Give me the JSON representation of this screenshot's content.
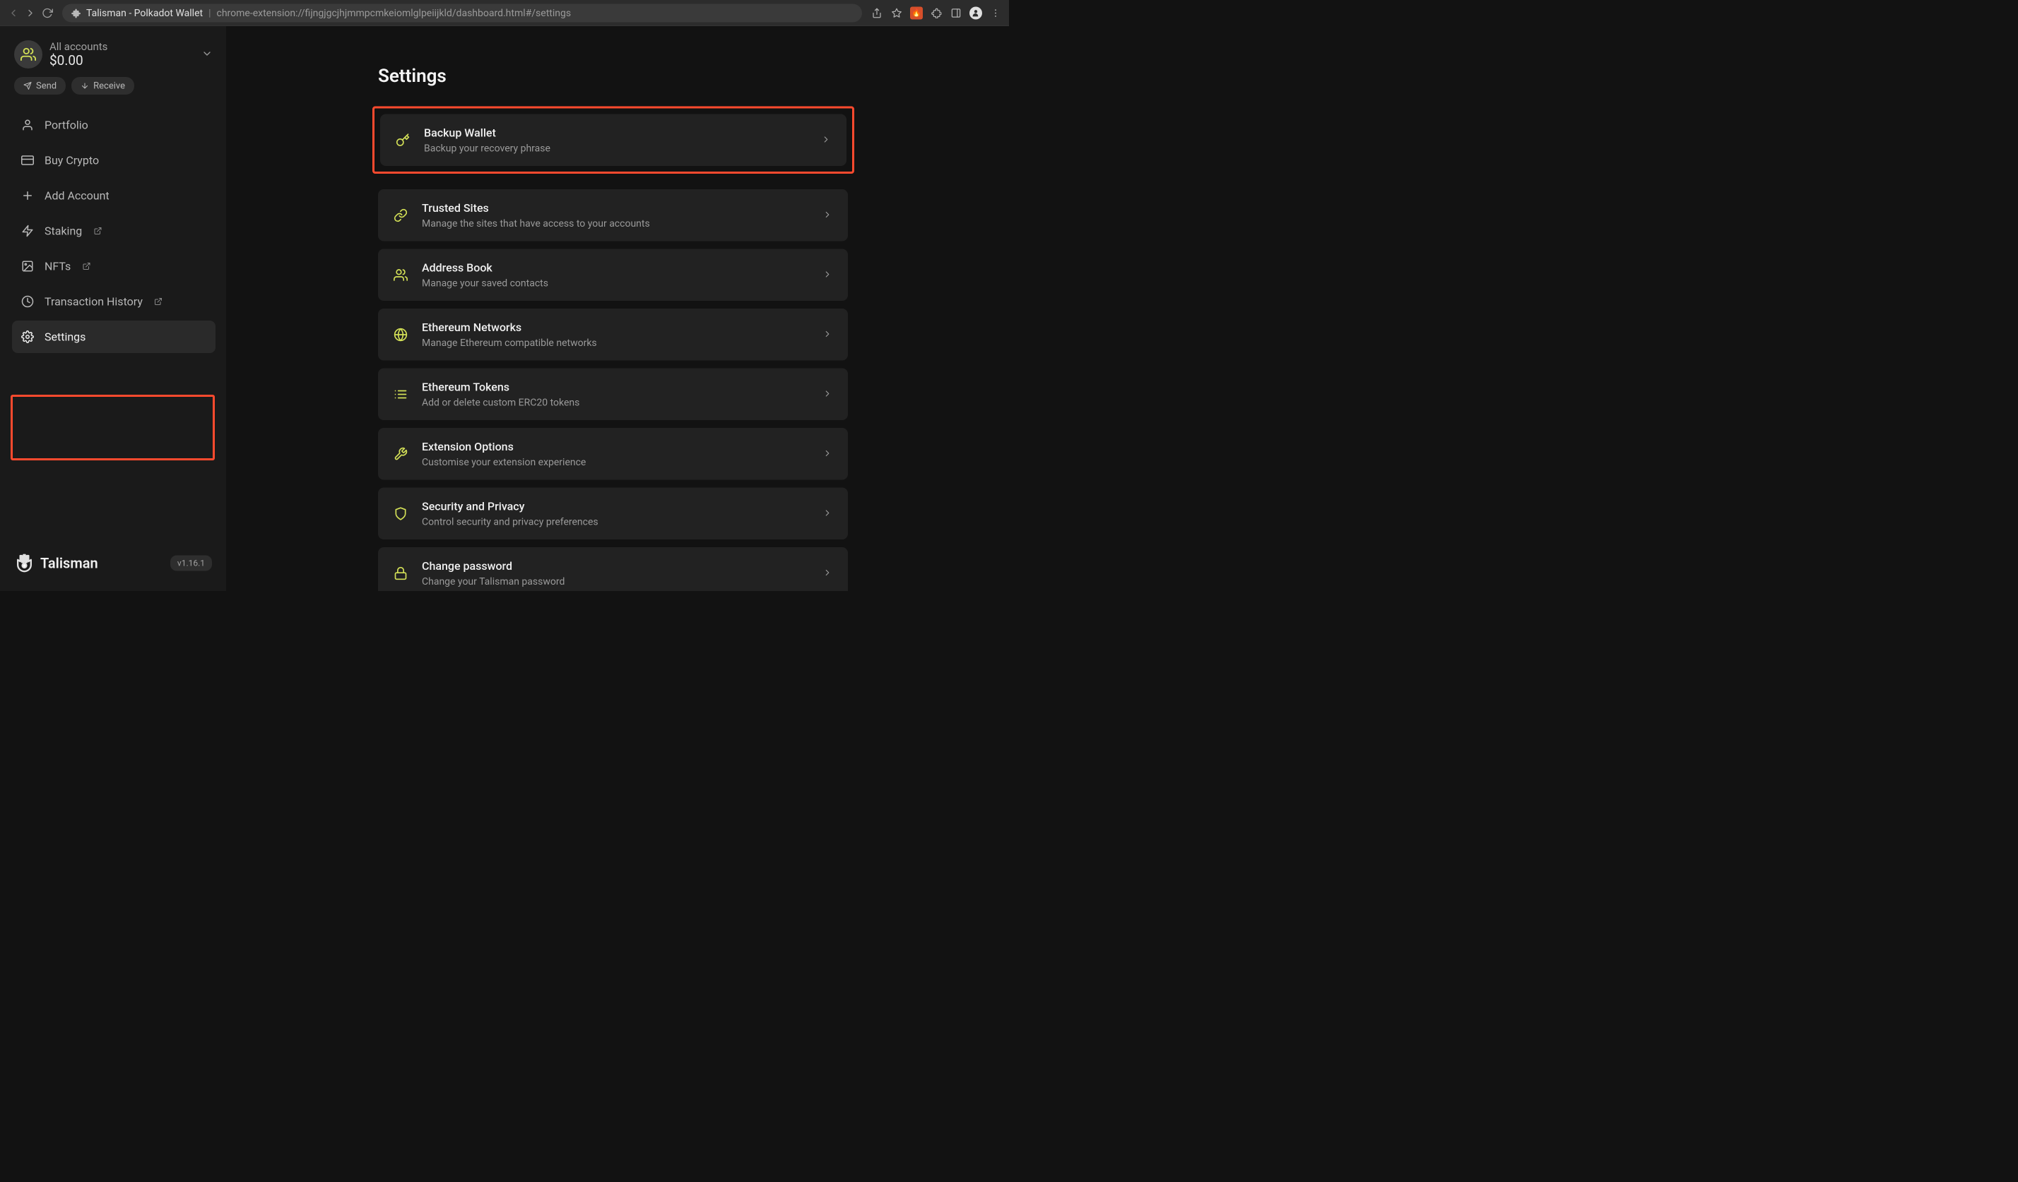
{
  "chrome": {
    "title": "Talisman - Polkadot Wallet",
    "url": "chrome-extension://fijngjgcjhjmmpcmkeiomlglpeiijkld/dashboard.html#/settings"
  },
  "sidebar": {
    "account_label": "All accounts",
    "account_balance": "$0.00",
    "send_label": "Send",
    "receive_label": "Receive",
    "items": [
      {
        "label": "Portfolio"
      },
      {
        "label": "Buy Crypto"
      },
      {
        "label": "Add Account"
      },
      {
        "label": "Staking"
      },
      {
        "label": "NFTs"
      },
      {
        "label": "Transaction History"
      },
      {
        "label": "Settings"
      }
    ],
    "brand": "Talisman",
    "version": "v1.16.1"
  },
  "main": {
    "title": "Settings",
    "rows": [
      {
        "title": "Backup Wallet",
        "desc": "Backup your recovery phrase"
      },
      {
        "title": "Trusted Sites",
        "desc": "Manage the sites that have access to your accounts"
      },
      {
        "title": "Address Book",
        "desc": "Manage your saved contacts"
      },
      {
        "title": "Ethereum Networks",
        "desc": "Manage Ethereum compatible networks"
      },
      {
        "title": "Ethereum Tokens",
        "desc": "Add or delete custom ERC20 tokens"
      },
      {
        "title": "Extension Options",
        "desc": "Customise your extension experience"
      },
      {
        "title": "Security and Privacy",
        "desc": "Control security and privacy preferences"
      },
      {
        "title": "Change password",
        "desc": "Change your Talisman password"
      }
    ]
  }
}
